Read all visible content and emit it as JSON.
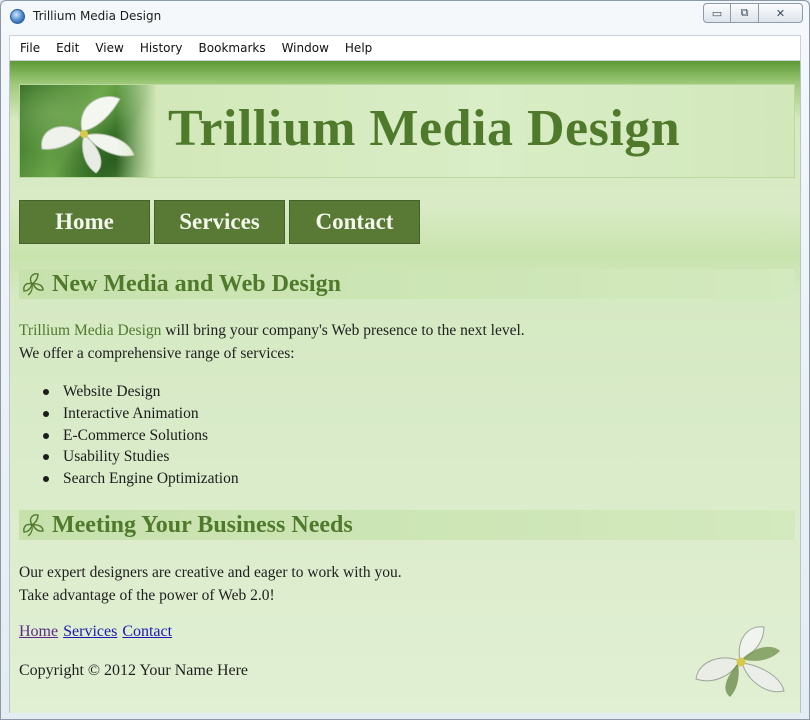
{
  "window": {
    "title": "Trillium Media Design",
    "controls": {
      "minimize": "▭",
      "maximize": "⧉",
      "close": "✕"
    }
  },
  "menu": [
    "File",
    "Edit",
    "View",
    "History",
    "Bookmarks",
    "Window",
    "Help"
  ],
  "page": {
    "banner_title": "Trillium Media Design",
    "nav": {
      "home": "Home",
      "services": "Services",
      "contact": "Contact"
    },
    "section1": {
      "heading": "New Media and Web Design",
      "intro_brand": "Trillium Media Design",
      "intro_rest": " will bring your company's Web presence to the next level.",
      "intro_line2": "We offer a comprehensive range of services:",
      "services": [
        "Website Design",
        "Interactive Animation",
        "E-Commerce Solutions",
        "Usability Studies",
        "Search Engine Optimization"
      ]
    },
    "section2": {
      "heading": "Meeting Your Business Needs",
      "line1": "Our expert designers are creative and eager to work with you.",
      "line2": "Take advantage of the power of Web 2.0!"
    },
    "footer_links": {
      "home": "Home",
      "services": "Services",
      "contact": "Contact"
    },
    "copyright": "Copyright © 2012 Your Name Here"
  },
  "colors": {
    "brand_green": "#4f7a2c",
    "nav_green": "#587a35",
    "link_blue": "#1a1ab0",
    "visited_purple": "#5b2a86"
  },
  "icons": {
    "app": "browser-globe-icon",
    "section_bullet": "trillium-outline-icon",
    "banner_image": "trillium-flower-photo",
    "corner_image": "trillium-flower-icon"
  }
}
